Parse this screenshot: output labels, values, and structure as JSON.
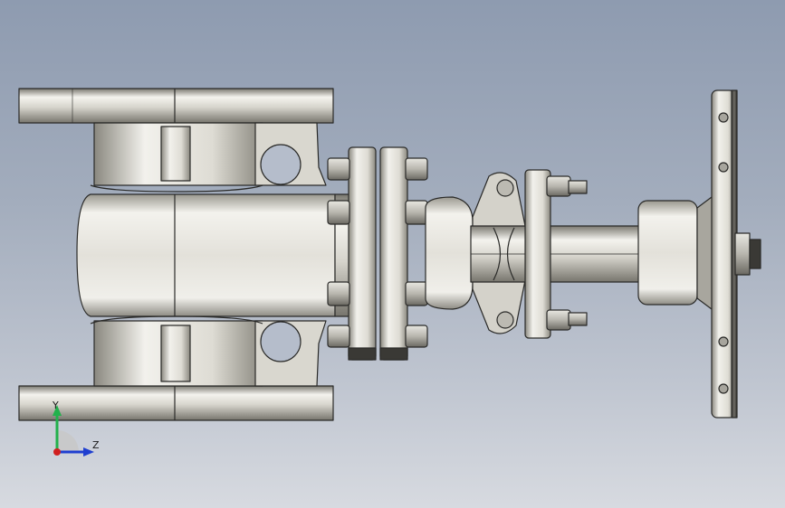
{
  "viewport": {
    "background_top": "#8e9bb0",
    "background_bottom": "#d7dae0"
  },
  "model": {
    "colors": {
      "metal_light": "#f2f1ec",
      "metal_mid": "#c9c7bf",
      "metal_dark": "#6f6d66",
      "edge": "#2a2a28"
    }
  },
  "triad": {
    "y_label": "Y",
    "z_label": "Z",
    "y_color": "#22b14c",
    "z_color": "#1f3fd0",
    "x_color": "#d01f1f"
  }
}
